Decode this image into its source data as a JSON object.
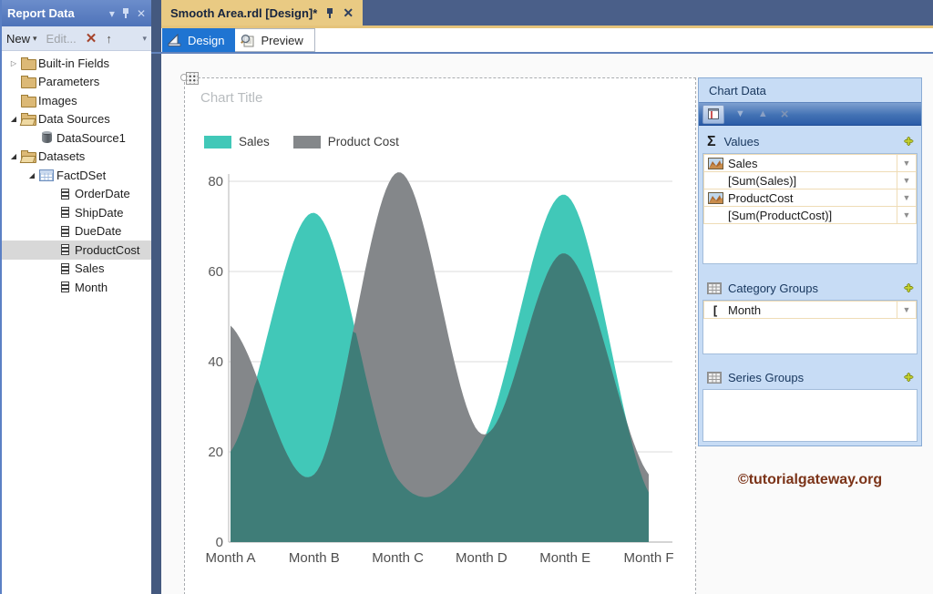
{
  "report_data_panel": {
    "title": "Report Data",
    "header_icons": {
      "menu": "▾",
      "pin": "pin",
      "close": "✕"
    },
    "toolbar": {
      "new_label": "New",
      "edit_label": "Edit...",
      "delete_icon": "✕",
      "up_icon": "↑",
      "overflow_icon": "▾"
    },
    "tree": [
      {
        "label": "Built-in Fields",
        "icon": "folder",
        "arrow": "collapsed",
        "level": 0,
        "selected": false
      },
      {
        "label": "Parameters",
        "icon": "folder",
        "arrow": "none",
        "level": 0,
        "selected": false
      },
      {
        "label": "Images",
        "icon": "folder",
        "arrow": "none",
        "level": 0,
        "selected": false
      },
      {
        "label": "Data Sources",
        "icon": "folder-open",
        "arrow": "expanded",
        "level": 0,
        "selected": false
      },
      {
        "label": "DataSource1",
        "icon": "database",
        "arrow": "none",
        "level": 1,
        "selected": false
      },
      {
        "label": "Datasets",
        "icon": "folder-open",
        "arrow": "expanded",
        "level": 0,
        "selected": false
      },
      {
        "label": "FactDSet",
        "icon": "table",
        "arrow": "expanded",
        "level": 1,
        "selected": false
      },
      {
        "label": "OrderDate",
        "icon": "field",
        "arrow": "none",
        "level": 2,
        "selected": false
      },
      {
        "label": "ShipDate",
        "icon": "field",
        "arrow": "none",
        "level": 2,
        "selected": false
      },
      {
        "label": "DueDate",
        "icon": "field",
        "arrow": "none",
        "level": 2,
        "selected": false
      },
      {
        "label": "ProductCost",
        "icon": "field",
        "arrow": "none",
        "level": 2,
        "selected": true
      },
      {
        "label": "Sales",
        "icon": "field",
        "arrow": "none",
        "level": 2,
        "selected": false
      },
      {
        "label": "Month",
        "icon": "field",
        "arrow": "none",
        "level": 2,
        "selected": false
      }
    ]
  },
  "document_tab": {
    "label": "Smooth Area.rdl [Design]*",
    "close_icon": "✕"
  },
  "view_toolbar": {
    "design_label": "Design",
    "preview_label": "Preview"
  },
  "chart_data": {
    "type": "area",
    "smooth": true,
    "title": "Chart Title",
    "categories": [
      "Month A",
      "Month B",
      "Month C",
      "Month D",
      "Month E",
      "Month F"
    ],
    "series": [
      {
        "name": "Sales",
        "legend_label": "Sales",
        "color": "#41C8B8",
        "values": [
          20,
          73,
          14,
          22,
          77,
          11
        ]
      },
      {
        "name": "Product Cost",
        "legend_label": "Product Cost",
        "color": "#84878A",
        "values": [
          48,
          15,
          82,
          24,
          64,
          15
        ]
      }
    ],
    "overlap_color": "#3F7D78",
    "ylim": [
      0,
      80
    ],
    "yticks": [
      0,
      20,
      40,
      60,
      80
    ],
    "grid": true,
    "legend_position": "top-left",
    "xlabel": "",
    "ylabel": ""
  },
  "chart_data_pane": {
    "title": "Chart Data",
    "values_section": {
      "label": "Values",
      "rows": [
        {
          "label": "Sales",
          "kind": "series"
        },
        {
          "label": "[Sum(Sales)]",
          "kind": "expression"
        },
        {
          "label": "ProductCost",
          "kind": "series"
        },
        {
          "label": "[Sum(ProductCost)]",
          "kind": "expression"
        }
      ]
    },
    "category_section": {
      "label": "Category Groups",
      "rows": [
        {
          "label": "Month",
          "kind": "group"
        }
      ]
    },
    "series_section": {
      "label": "Series Groups",
      "rows": []
    }
  },
  "watermark": "©tutorialgateway.org",
  "colors": {
    "sales_area": "#41C8B8",
    "cost_area": "#84878A",
    "overlap_area": "#3F7D78",
    "tab_active": "#E9CA83",
    "env_background": "#44597F",
    "design_button": "#1F74D2",
    "pane_background": "#C7DCF5",
    "watermark_text": "#7B3318"
  }
}
